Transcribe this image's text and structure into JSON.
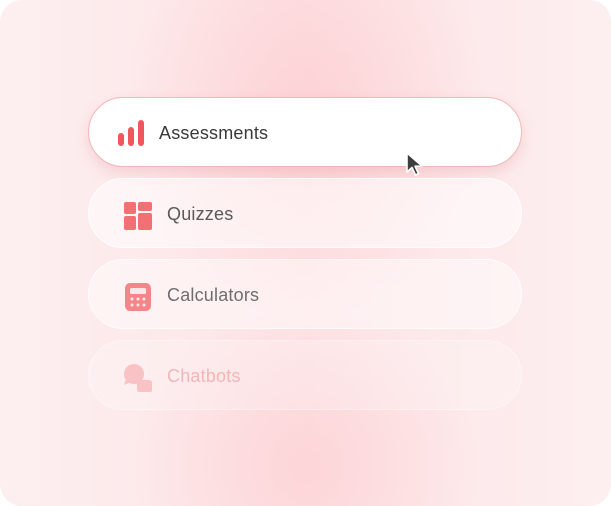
{
  "menu": {
    "items": [
      {
        "label": "Assessments",
        "icon": "bar-chart-icon",
        "state": "hovered"
      },
      {
        "label": "Quizzes",
        "icon": "grid-blocks-icon",
        "state": "default"
      },
      {
        "label": "Calculators",
        "icon": "calculator-icon",
        "state": "default"
      },
      {
        "label": "Chatbots",
        "icon": "chat-bubbles-icon",
        "state": "faded"
      }
    ]
  },
  "colors": {
    "accent": "#f0575c",
    "accent_soft": "#f48689",
    "accent_faded": "#f9c2c4",
    "active_border": "#f3b7b9",
    "background": "#fde5e7"
  },
  "cursor": {
    "icon": "mouse-pointer-icon"
  }
}
